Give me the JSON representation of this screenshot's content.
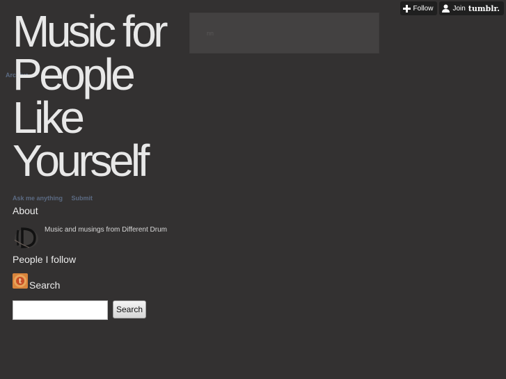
{
  "tumblr_bar": {
    "follow_label": "Follow",
    "join_label": "Join",
    "brand": "tumblr."
  },
  "blog": {
    "title": "Music for People Like Yourself",
    "archive_link": "Archive"
  },
  "top_box": {
    "faint_text": "nn"
  },
  "nav_links": {
    "ask": "Ask me anything",
    "submit": "Submit"
  },
  "about": {
    "heading": "About",
    "description": "Music and musings from Different Drum"
  },
  "following": {
    "heading": "People I follow"
  },
  "search": {
    "heading": "Search",
    "input_value": "",
    "button_label": "Search"
  },
  "colors": {
    "background": "#333131",
    "link": "#5b6a82",
    "title": "#e8e8e8",
    "top_box": "#434141"
  }
}
